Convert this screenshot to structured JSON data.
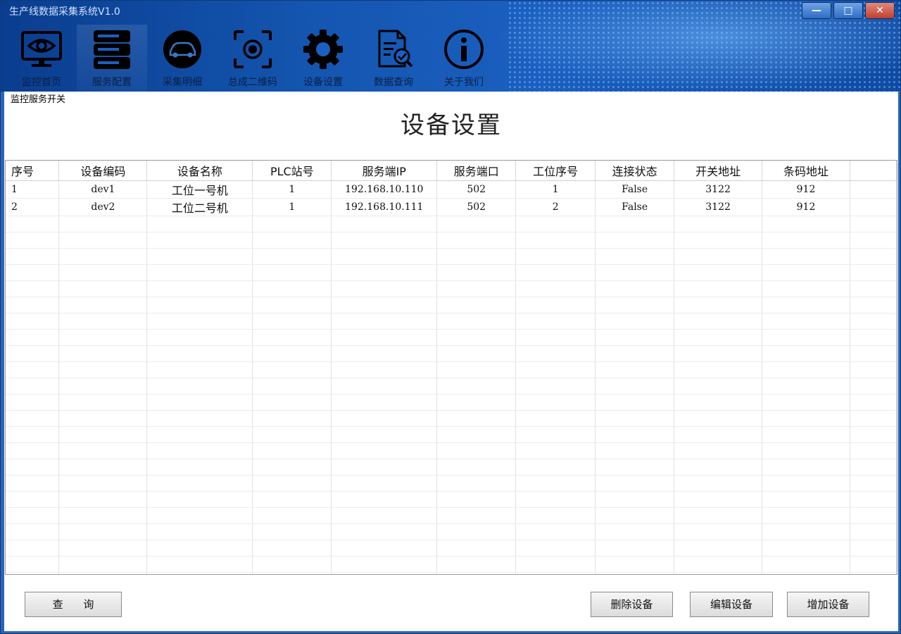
{
  "window": {
    "title": "生产线数据采集系统V1.0",
    "controls": {
      "minimize": "—",
      "maximize": "□",
      "close": "✕"
    }
  },
  "nav": {
    "items": [
      {
        "label": "监控首页",
        "icon": "monitor-eye-icon",
        "active": false
      },
      {
        "label": "服务配置",
        "icon": "server-icon",
        "active": true
      },
      {
        "label": "采集明细",
        "icon": "car-icon",
        "active": false
      },
      {
        "label": "总成二维码",
        "icon": "scan-icon",
        "active": false
      },
      {
        "label": "设备设置",
        "icon": "gear-icon",
        "active": false
      },
      {
        "label": "数据查询",
        "icon": "document-search-icon",
        "active": false
      },
      {
        "label": "关于我们",
        "icon": "info-icon",
        "active": false
      }
    ]
  },
  "content": {
    "switch_label": "监控服务开关",
    "page_title": "设备设置"
  },
  "table": {
    "columns": [
      "序号",
      "设备编码",
      "设备名称",
      "PLC站号",
      "服务端IP",
      "服务端口",
      "工位序号",
      "连接状态",
      "开关地址",
      "条码地址"
    ],
    "rows": [
      [
        "1",
        "dev1",
        "工位一号机",
        "1",
        "192.168.10.110",
        "502",
        "1",
        "False",
        "3122",
        "912"
      ],
      [
        "2",
        "dev2",
        "工位二号机",
        "1",
        "192.168.10.111",
        "502",
        "2",
        "False",
        "3122",
        "912"
      ]
    ]
  },
  "buttons": {
    "query": "查 询",
    "delete": "删除设备",
    "edit": "编辑设备",
    "add": "增加设备"
  },
  "colors": {
    "header_dark": "#0a3d8f",
    "header_light": "#1b5fc0",
    "accent": "#2a64b5"
  }
}
